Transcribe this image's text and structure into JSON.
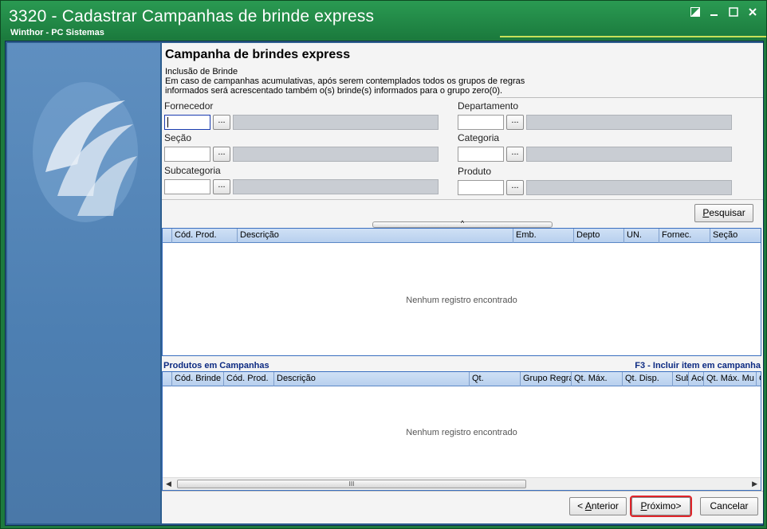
{
  "window": {
    "title": "3320 - Cadastrar Campanhas de brinde express",
    "subtitle": "Winthor - PC Sistemas"
  },
  "page": {
    "heading": "Campanha de brindes express",
    "info_line1": "Inclusão de Brinde",
    "info_line2": "Em caso de campanhas acumulativas, após serem contemplados todos os grupos de regras",
    "info_line3": "informados será acrescentado também o(s) brinde(s) informados para o grupo zero(0)."
  },
  "filters": {
    "fornecedor": "Fornecedor",
    "departamento": "Departamento",
    "secao": "Seção",
    "categoria": "Categoria",
    "subcategoria": "Subcategoria",
    "produto": "Produto",
    "lookup_button": "..."
  },
  "search": {
    "button_prefix": "",
    "button_underlined": "P",
    "button_suffix": "esquisar",
    "splitter_glyph": "^"
  },
  "grid1": {
    "columns": [
      "Cód. Prod.",
      "Descrição",
      "Emb.",
      "Depto",
      "UN.",
      "Fornec.",
      "Seção"
    ],
    "empty_text": "Nenhum registro encontrado"
  },
  "section": {
    "title": "Produtos em Campanhas",
    "hint": "F3 - Incluir item em campanha"
  },
  "grid2": {
    "columns": [
      "Cód. Brinde",
      "Cód. Prod.",
      "Descrição",
      "Qt.",
      "Grupo Regra",
      "Qt. Máx.",
      "Qt. Disp.",
      "Sub",
      "Ace",
      "Qt. Máx. Mu",
      "C"
    ],
    "empty_text": "Nenhum registro encontrado",
    "scroll_thumb": "III"
  },
  "buttons": {
    "anterior_prefix": "< ",
    "anterior_underlined": "A",
    "anterior_suffix": "nterior",
    "proximo_underlined": "P",
    "proximo_suffix": "róximo>",
    "cancelar": "Cancelar"
  }
}
